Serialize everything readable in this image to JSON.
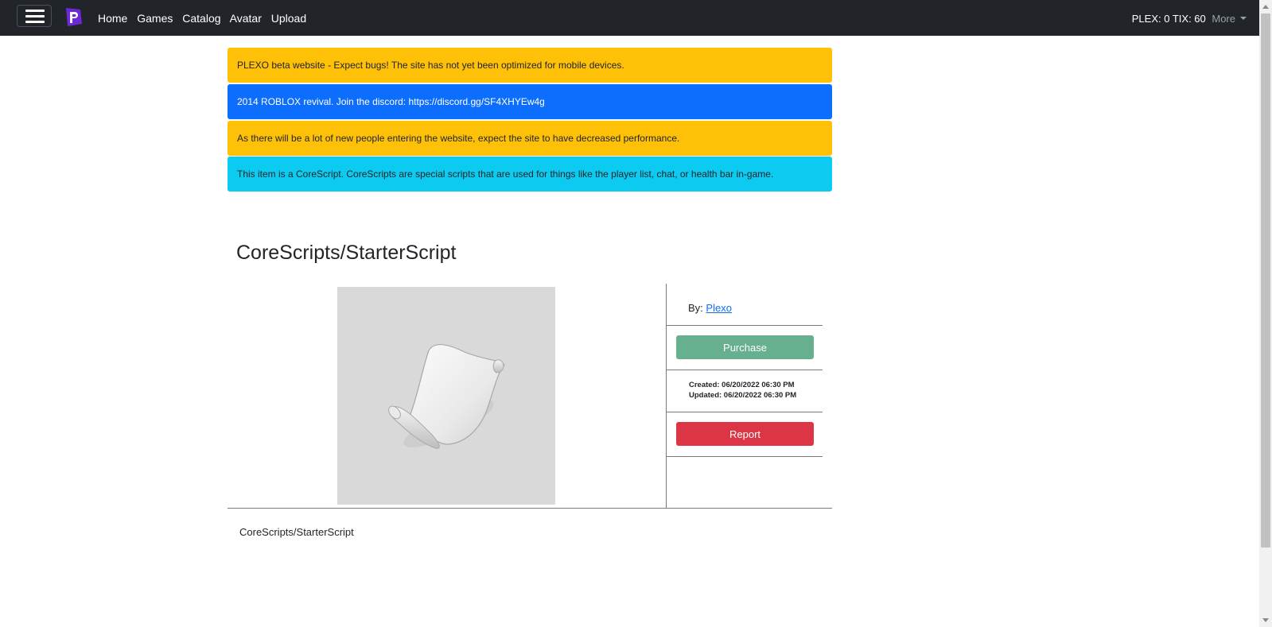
{
  "nav": {
    "links": [
      "Home",
      "Games",
      "Catalog",
      "Avatar",
      "Upload"
    ],
    "currency": "PLEX: 0 TIX: 60",
    "more": "More",
    "brand_color": "#5b21b6"
  },
  "alerts": [
    {
      "text": "PLEXO beta website - Expect bugs! The site has not yet been optimized for mobile devices.",
      "color": "#ffc107"
    },
    {
      "text": "2014 ROBLOX revival. Join the discord: https://discord.gg/SF4XHYEw4g",
      "color": "#0d6efd"
    },
    {
      "text": "As there will be a lot of new people entering the website, expect the site to have decreased performance.",
      "color": "#ffc107"
    },
    {
      "text": "This item is a CoreScript. CoreScripts are special scripts that are used for things like the player list, chat, or health bar in-game.",
      "color": "#0dcaf0"
    }
  ],
  "item": {
    "title": "CoreScripts/StarterScript",
    "by_label": "By:",
    "creator": "Plexo",
    "purchase_label": "Purchase",
    "created": "Created: 06/20/2022 06:30 PM",
    "updated": "Updated: 06/20/2022 06:30 PM",
    "report_label": "Report",
    "description": "CoreScripts/StarterScript",
    "image_icon": "scroll-icon"
  }
}
